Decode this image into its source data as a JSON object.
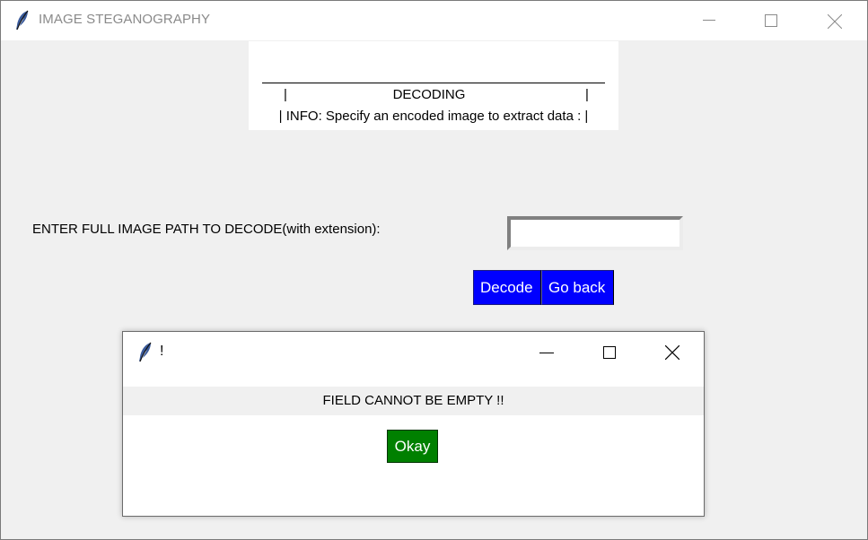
{
  "window": {
    "title": "IMAGE STEGANOGRAPHY",
    "icons": {
      "app": "feather-icon",
      "minimize": "minimize-icon",
      "maximize": "maximize-icon",
      "close": "close-icon"
    }
  },
  "info_box": {
    "left_pipe": "|",
    "heading": "DECODING",
    "right_pipe": "|",
    "info_text": "| INFO: Specify an encoded image to extract data : |"
  },
  "form": {
    "path_label": "ENTER FULL IMAGE PATH TO DECODE(with extension):",
    "path_value": "",
    "decode_label": "Decode",
    "go_back_label": "Go back"
  },
  "dialog": {
    "title": "!",
    "message": "FIELD CANNOT BE EMPTY !!",
    "okay_label": "Okay"
  },
  "colors": {
    "window_bg": "#f0f0f0",
    "blue_button": "#0000ff",
    "green_button": "#008000"
  }
}
